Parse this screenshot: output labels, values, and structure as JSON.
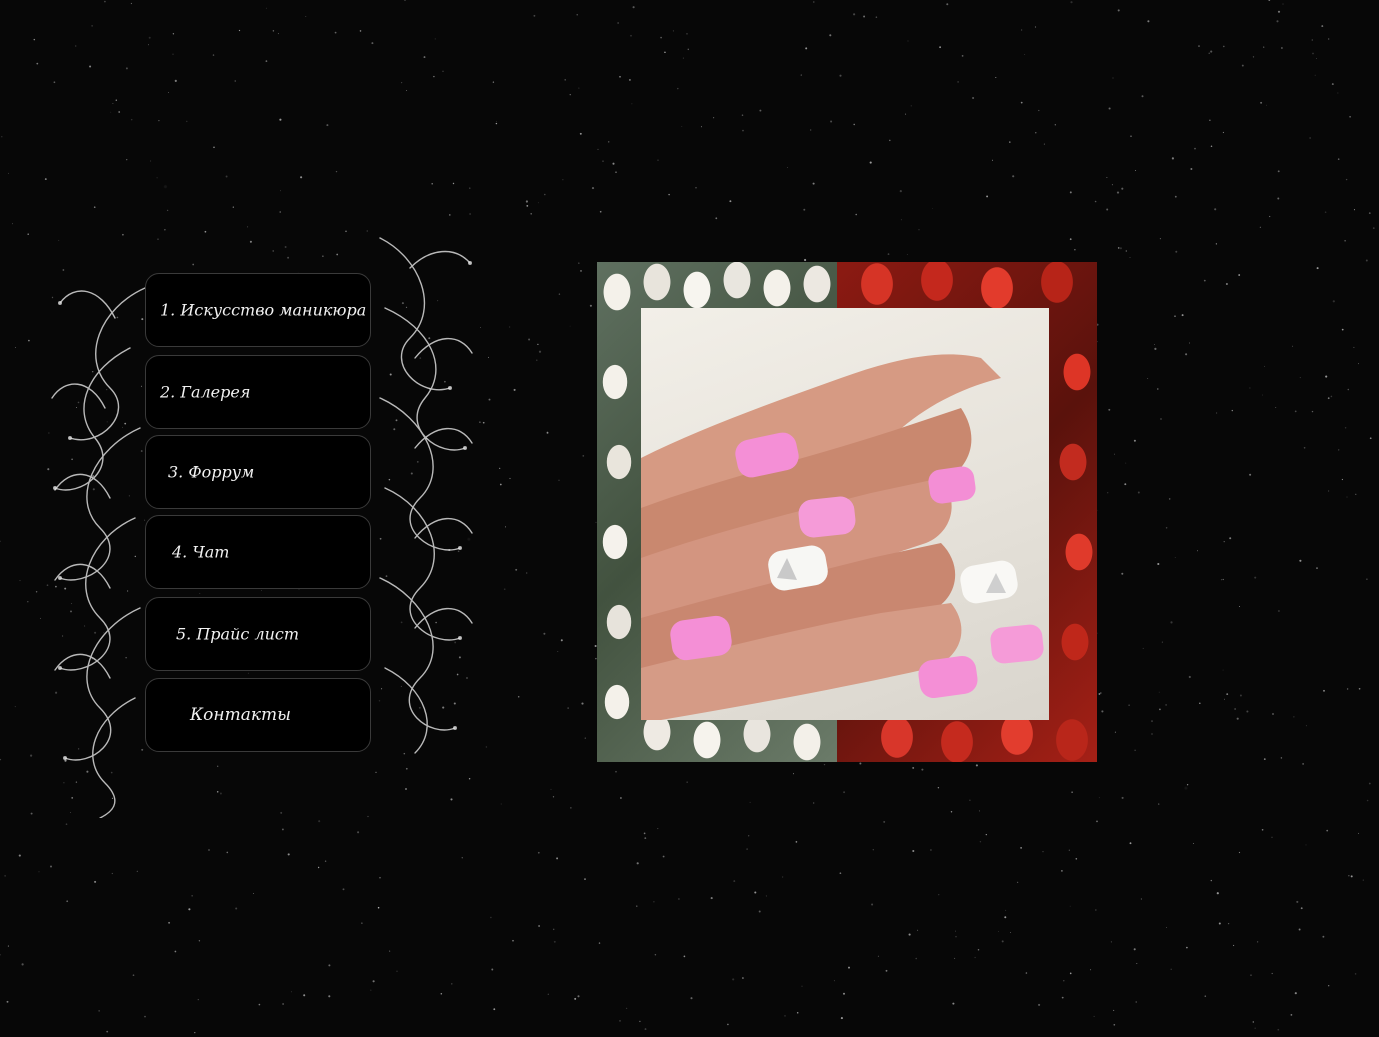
{
  "menu": {
    "items": [
      {
        "label": "1. Искусство маникюра"
      },
      {
        "label": "2. Галерея"
      },
      {
        "label": "3. Форрум"
      },
      {
        "label": "4. Чат"
      },
      {
        "label": "5. Прайс лист"
      },
      {
        "label": "Контакты"
      }
    ]
  },
  "gallery": {
    "image_icon": "manicure-photo"
  },
  "colors": {
    "background": "#070707",
    "menu_bg": "#000000",
    "menu_text": "#f2f2f2",
    "nail_pink": "#f48fd6"
  }
}
